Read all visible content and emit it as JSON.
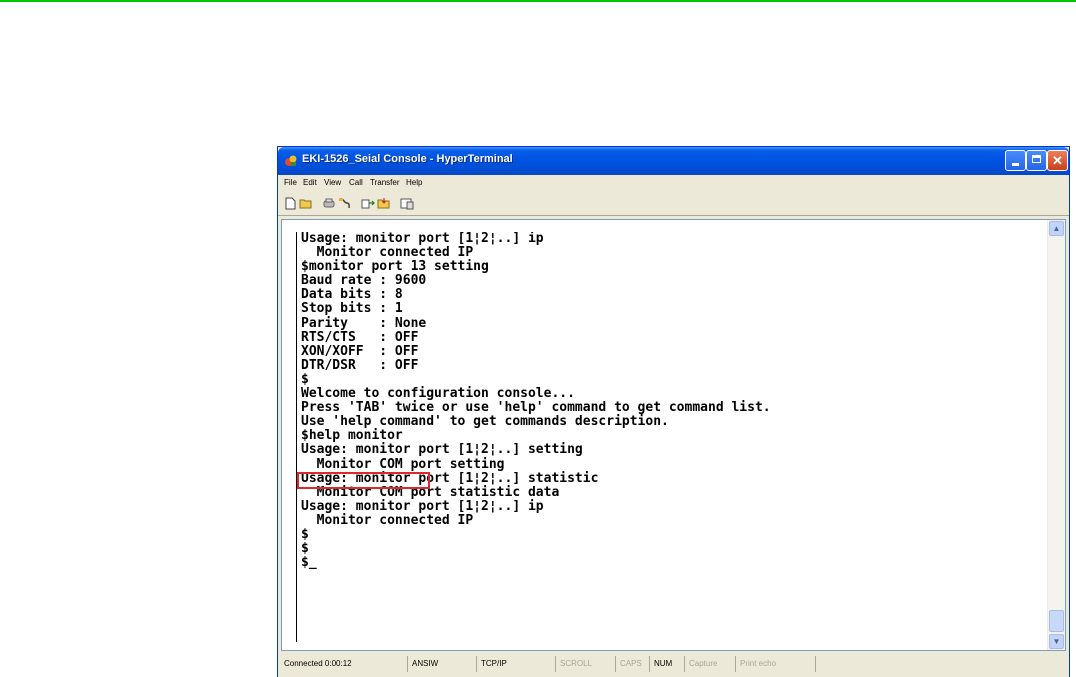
{
  "window": {
    "title": "EKI-1526_Seial Console - HyperTerminal",
    "colors": {
      "titlebar": "#0054e3",
      "highlight_box": "#e0262f",
      "top_rule": "#00c800"
    }
  },
  "menu": {
    "items": [
      "File",
      "Edit",
      "View",
      "Call",
      "Transfer",
      "Help"
    ]
  },
  "toolbar": {
    "icons": [
      "new-icon",
      "open-icon",
      "connect-icon",
      "disconnect-icon",
      "send-icon",
      "receive-icon",
      "properties-icon"
    ]
  },
  "terminal": {
    "lines": [
      "Usage: monitor port [1¦2¦..] ip",
      "  Monitor connected IP",
      "$monitor port 13 setting",
      "Baud rate : 9600",
      "Data bits : 8",
      "Stop bits : 1",
      "Parity    : None",
      "RTS/CTS   : OFF",
      "XON/XOFF  : OFF",
      "DTR/DSR   : OFF",
      "$",
      "Welcome to configuration console...",
      "Press 'TAB' twice or use 'help' command to get command list.",
      "Use 'help command' to get commands description.",
      "$help monitor",
      "Usage: monitor port [1¦2¦..] setting",
      "  Monitor COM port setting",
      "Usage: monitor port [1¦2¦..] statistic",
      "  Monitor COM port statistic data",
      "Usage: monitor port [1¦2¦..] ip",
      "  Monitor connected IP",
      "$",
      "$",
      "$_"
    ]
  },
  "status": {
    "connected": "Connected 0:00:12",
    "emulation": "ANSIW",
    "protocol": "TCP/IP",
    "scroll": "SCROLL",
    "caps": "CAPS",
    "num": "NUM",
    "capture": "Capture",
    "print_echo": "Print echo"
  }
}
